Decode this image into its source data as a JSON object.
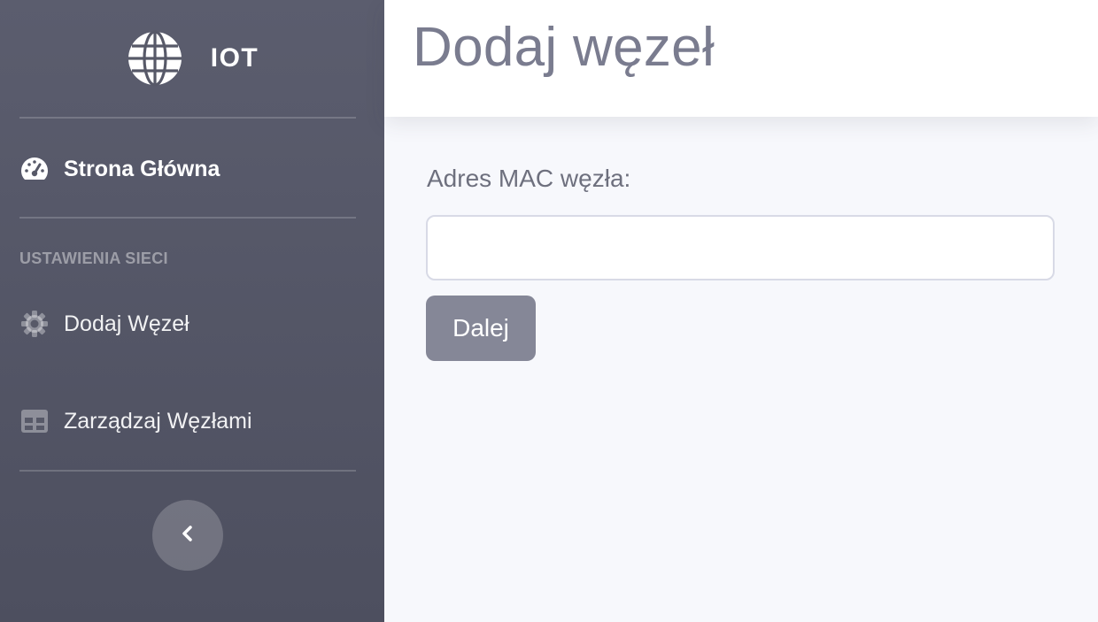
{
  "brand": {
    "title": "IOT",
    "icon": "globe-icon"
  },
  "sidebar": {
    "items": [
      {
        "label": "Strona Główna",
        "icon": "dashboard-gauge-icon",
        "active": true
      },
      {
        "label": "Dodaj Węzeł",
        "icon": "gear-icon",
        "active": false
      },
      {
        "label": "Zarządzaj Węzłami",
        "icon": "table-icon",
        "active": false
      }
    ],
    "heading": "USTAWIENIA SIECI",
    "toggle_icon": "chevron-left-icon"
  },
  "page": {
    "title": "Dodaj węzeł"
  },
  "form": {
    "mac_label": "Adres MAC węzła:",
    "mac_value": "",
    "submit_label": "Dalej"
  },
  "colors": {
    "sidebar_bg": "#575968",
    "content_bg": "#f7f8fc",
    "button_bg": "#858797",
    "title_color": "#7a7c8f"
  }
}
